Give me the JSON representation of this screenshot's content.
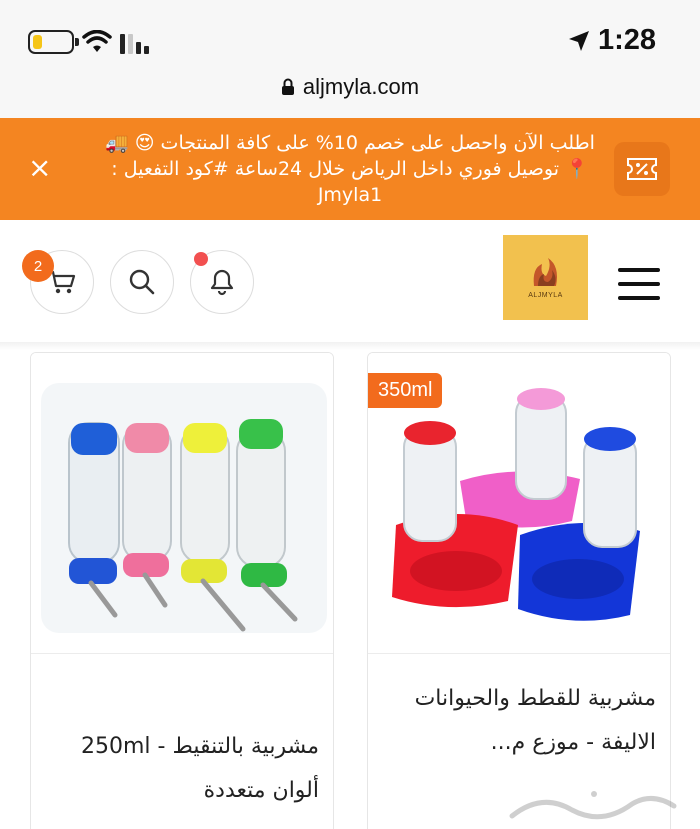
{
  "status_bar": {
    "time": "1:28",
    "url": "aljmyla.com",
    "battery_level": 0.25,
    "battery_color": "#f5c518"
  },
  "promo": {
    "text": "اطلب الآن واحصل على خصم 10% على كافة المنتجات 😍 🚚📍 توصيل فوري داخل الرياض خلال 24ساعة #كود التفعيل : Jmyla1",
    "close_label": "×",
    "background": "#f48521",
    "icon": "discount-coupon-icon"
  },
  "header": {
    "cart_count": "2",
    "logo_text": "ALJMYLA",
    "icons": [
      "cart-icon",
      "search-icon",
      "bell-icon",
      "menu-icon"
    ],
    "accent": "#f26b1d"
  },
  "products": [
    {
      "title": "مشربية للقطط والحيوانات الاليفة - موزع م...",
      "badge": "350ml",
      "image": "pet-water-dispenser-image"
    },
    {
      "title": "مشربية بالتنقيط - 250ml ألوان متعددة",
      "image": "drip-water-bottles-image"
    }
  ],
  "watermark": "حراج"
}
